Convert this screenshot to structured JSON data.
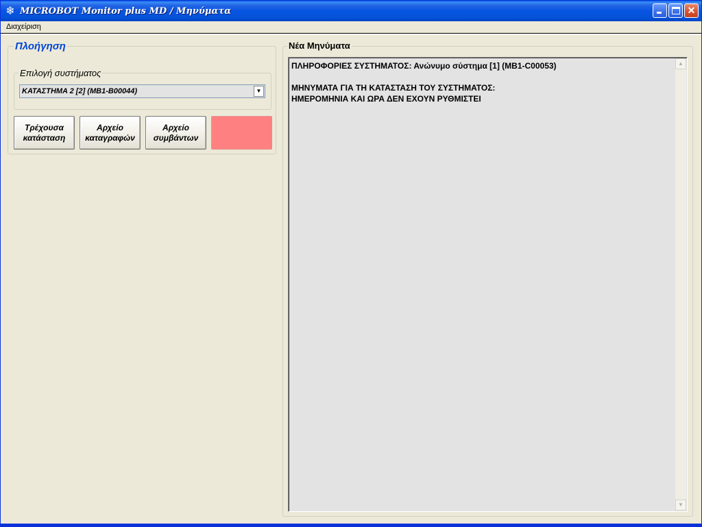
{
  "window": {
    "title": "MICROBOT Monitor plus MD / Μηνύματα",
    "icon": "snowflake-icon"
  },
  "menu": {
    "items": [
      "Διαχείριση"
    ]
  },
  "navigation": {
    "title": "Πλοήγηση",
    "system_select": {
      "label": "Επιλογή συστήματος",
      "value": "ΚΑΤΑΣΤΗΜΑ 2 [2] (MB1-B00044)"
    },
    "buttons": [
      {
        "line1": "Τρέχουσα",
        "line2": "κατάσταση"
      },
      {
        "line1": "Αρχείο",
        "line2": "καταγραφών"
      },
      {
        "line1": "Αρχείο",
        "line2": "συμβάντων"
      },
      {
        "line1": "",
        "line2": ""
      }
    ]
  },
  "messages": {
    "title": "Νέα Μηνύματα",
    "lines": [
      "ΠΛΗΡΟΦΟΡΙΕΣ ΣΥΣΤΗΜΑΤΟΣ: Ανώνυμο σύστημα [1] (MB1-C00053)",
      "",
      "ΜΗΝΥΜΑΤΑ ΓΙΑ ΤΗ ΚΑΤΑΣΤΑΣΗ ΤΟΥ ΣΥΣΤΗΜΑΤΟΣ:",
      "ΗΜΕΡΟΜΗΝΙΑ ΚΑΙ ΩΡΑ ΔΕΝ ΕΧΟΥΝ ΡΥΘΜΙΣΤΕΙ"
    ]
  },
  "colors": {
    "titlebar": "#0854e3",
    "group_title": "#0046d5",
    "alarm_button": "#ff8080",
    "window_bg": "#ece9d8",
    "text_area_bg": "#e3e3e3"
  }
}
